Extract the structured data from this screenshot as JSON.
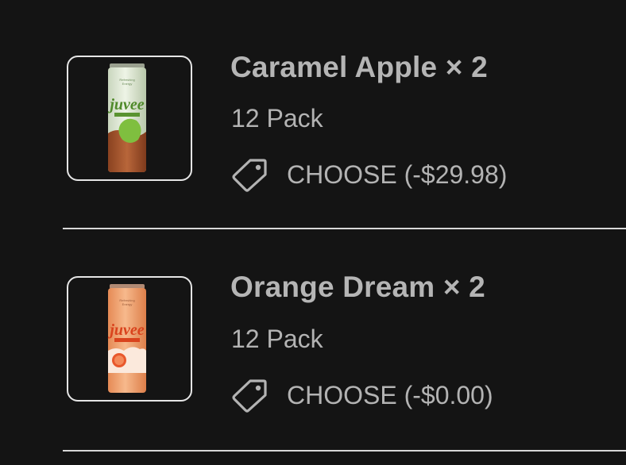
{
  "items": [
    {
      "title": "Caramel Apple × 2",
      "variant": "12 Pack",
      "discount": "CHOOSE (-$29.98)",
      "product_image": "juvee-caramel-apple-can",
      "can_colors": {
        "top": "#e9f1e0",
        "mid": "#7aa84a",
        "bottom": "#a3562a",
        "label": "#4f8a2a"
      }
    },
    {
      "title": "Orange Dream × 2",
      "variant": "12 Pack",
      "discount": "CHOOSE (-$0.00)",
      "product_image": "juvee-orange-dream-can",
      "can_colors": {
        "top": "#f6b489",
        "mid": "#f2a06a",
        "bottom": "#f5c29a",
        "label": "#d9431d"
      }
    }
  ],
  "icons": {
    "discount": "tag-icon"
  },
  "colors": {
    "background": "#141414",
    "text": "#b3b3b3",
    "border": "#e6e6e6"
  }
}
